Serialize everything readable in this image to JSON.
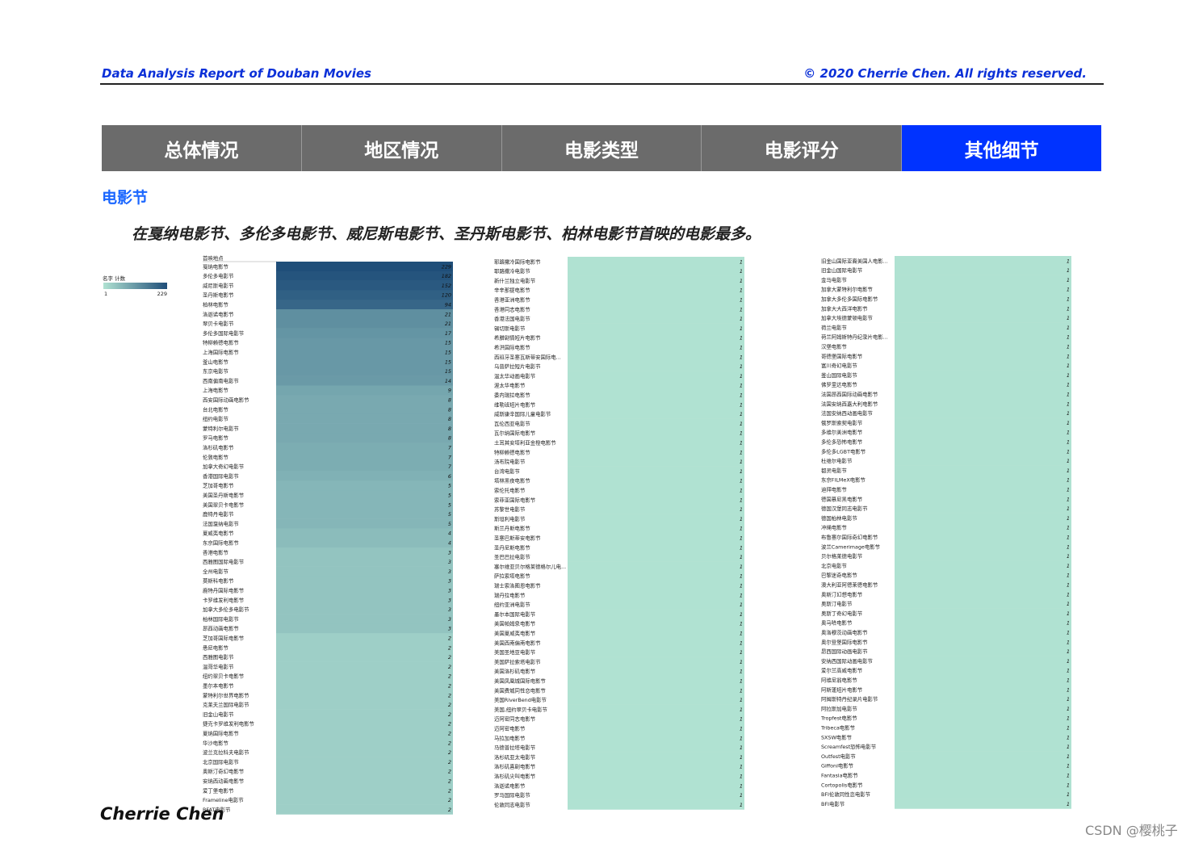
{
  "header": {
    "left": "Data Analysis Report of Douban Movies",
    "right": "© 2020 Cherrie Chen. All rights reserved."
  },
  "tabs": [
    {
      "label": "总体情况",
      "active": false
    },
    {
      "label": "地区情况",
      "active": false
    },
    {
      "label": "电影类型",
      "active": false
    },
    {
      "label": "电影评分",
      "active": false
    },
    {
      "label": "其他细节",
      "active": true
    }
  ],
  "section_title": "电影节",
  "summary": "在戛纳电影节、多伦多电影节、威尼斯电影节、圣丹斯电影节、柏林电影节首映的电影最多。",
  "author": "Cherrie Chen",
  "watermark": "CSDN @樱桃子",
  "colors": {
    "tab_bg": "#6b6b6b",
    "tab_active": "#0033ff",
    "accent_blue": "#1a66ff",
    "heat_low": "#b0e2d2",
    "heat_high": "#1f4e79"
  },
  "chart_data": {
    "type": "heatmap",
    "header_label": "首映地点",
    "legend": {
      "title": "名字 计数",
      "min_label": "1",
      "max_label": "229",
      "min": 1,
      "max": 229
    },
    "columns": [
      {
        "categories": [
          "戛纳电影节",
          "多伦多电影节",
          "威尼斯电影节",
          "圣丹斯电影节",
          "柏林电影节",
          "洛迦诺电影节",
          "翠贝卡电影节",
          "多伦多国际电影节",
          "特柳赖德电影节",
          "上海国际电影节",
          "釜山电影节",
          "东京电影节",
          "西南偏南电影节",
          "上海电影节",
          "西安国际动画电影节",
          "台北电影节",
          "纽约电影节",
          "蒙特利尔电影节",
          "罗马电影节",
          "洛杉矶电影节",
          "伦敦电影节",
          "加拿大奇幻电影节",
          "香港国际电影节",
          "芝加哥电影节",
          "美国圣丹斯电影节",
          "美国翠贝卡电影节",
          "鹿特丹电影节",
          "法国戛纳电影节",
          "夏威夷电影节",
          "东京国际电影节",
          "香港电影节",
          "西雅图国际电影节",
          "全州电影节",
          "莫斯科电影节",
          "鹿特丹国际电影节",
          "卡罗维发利电影节",
          "加拿大多伦多电影节",
          "柏林国际电影节",
          "昂西动画电影节",
          "芝加哥国际电影节",
          "悉尼电影节",
          "西雅图电影节",
          "温哥华电影节",
          "纽约翠贝卡电影节",
          "墨尔本电影节",
          "蒙特利尔世界电影节",
          "克莱夫兰国际电影节",
          "旧金山电影节",
          "捷克卡罗维发利电影节",
          "夏纳国际电影节",
          "华沙电影节",
          "波兰克拉科夫电影节",
          "北京国际电影节",
          "奥斯汀奇幻电影节",
          "安纳西动画电影节",
          "爱丁堡电影节",
          "Frameline电影节",
          "BFAT电影节"
        ],
        "values": [
          229,
          182,
          152,
          120,
          94,
          21,
          21,
          17,
          15,
          15,
          15,
          15,
          14,
          9,
          8,
          8,
          8,
          8,
          8,
          7,
          7,
          7,
          6,
          5,
          5,
          5,
          5,
          5,
          4,
          4,
          3,
          3,
          3,
          3,
          3,
          3,
          3,
          3,
          3,
          2,
          2,
          2,
          2,
          2,
          2,
          2,
          2,
          2,
          2,
          2,
          2,
          2,
          2,
          2,
          2,
          2,
          2,
          2
        ]
      },
      {
        "categories": [
          "耶路撒冷国际电影节",
          "耶路撒冷电影节",
          "新什兰独立电影节",
          "辛辛那提电影节",
          "香港亚洲电影节",
          "香港同志电影节",
          "香港法国电影节",
          "锡切斯电影节",
          "希腊剧情短片电影节",
          "希洪国际电影节",
          "西班牙圣塞瓦斯蒂安国际电...",
          "乌普萨拉短片电影节",
          "温太华动画电影节",
          "渥太华电影节",
          "委内瑞拉电影节",
          "维勒班短片电影节",
          "威斯康辛国际儿童电影节",
          "瓦伦西亚电影节",
          "瓦尔纳国际电影节",
          "土耳其安塔利亚金橙电影节",
          "特柳赖德电影节",
          "汤布院电影节",
          "台湾电影节",
          "塔林黑夜电影节",
          "索伦托电影节",
          "索菲亚国际电影节",
          "苏黎世电影节",
          "斯坦利电影节",
          "斯兰丹斯电影节",
          "圣塞巴斯蒂安电影节",
          "圣丹尼斯电影节",
          "圣巴巴拉电影节",
          "塞尔维亚贝尔格莱德格尔儿电...",
          "萨拉索塔电影节",
          "瑞士索洛图恩电影节",
          "瑞丹拉电影节",
          "纽约亚洲电影节",
          "墨尔本国际电影节",
          "美国帕姆泉电影节",
          "美国夏威夷电影节",
          "美国西南偏南电影节",
          "美国圣地亚电影节",
          "美国萨拉索塔电影节",
          "美国洛杉矶电影节",
          "美国凤凰城国际电影节",
          "美国费城同性恋电影节",
          "美国RiverBend电影节",
          "美国,纽约翠贝卡电影节",
          "迈阿密同志电影节",
          "迈阿密电影节",
          "马拉加电影节",
          "马德普拉塔电影节",
          "洛杉矶亚太电影节",
          "洛杉矶喜剧电影节",
          "洛杉矶尖叫电影节",
          "洛迦诺电影节",
          "罗马国际电影节",
          "伦敦同志电影节"
        ],
        "values": [
          1,
          1,
          1,
          1,
          1,
          1,
          1,
          1,
          1,
          1,
          1,
          1,
          1,
          1,
          1,
          1,
          1,
          1,
          1,
          1,
          1,
          1,
          1,
          1,
          1,
          1,
          1,
          1,
          1,
          1,
          1,
          1,
          1,
          1,
          1,
          1,
          1,
          1,
          1,
          1,
          1,
          1,
          1,
          1,
          1,
          1,
          1,
          1,
          1,
          1,
          1,
          1,
          1,
          1,
          1,
          1,
          1,
          1
        ]
      },
      {
        "categories": [
          "旧金山国际亚裔美国人电影...",
          "旧金山国际电影节",
          "金马电影节",
          "加拿大蒙特利尔电影节",
          "加拿大多伦多国际电影节",
          "加拿大大西洋电影节",
          "加拿大埃德蒙顿电影节",
          "荷兰电影节",
          "荷兰阿姆斯特丹纪录片电影...",
          "汉堡电影节",
          "哥德堡国际电影节",
          "富川奇幻电影节",
          "釜山国际电影节",
          "佛罗里达电影节",
          "法国昂西国际动画电影节",
          "法国安纳西嘉大利电影节",
          "法国安纳西动画电影节",
          "俄罗斯索契电影节",
          "多维尔美洲电影节",
          "多伦多恐怖电影节",
          "多伦多LGBT电影节",
          "杜维尔电影节",
          "都灵电影节",
          "东京FILMeX电影节",
          "迪拜电影节",
          "德国慕尼黑电影节",
          "德国汉堡同志电影节",
          "德国柏林电影节",
          "冲绳电影节",
          "布鲁塞尔国际奇幻电影节",
          "波兰Camerimage电影节",
          "贝尔格莱德电影节",
          "北京电影节",
          "巴黎迷奇电影节",
          "澳大利亚阿德莱德电影节",
          "奥斯汀幻想电影节",
          "奥斯汀电影节",
          "奥斯丁奇幻电影节",
          "奥马哈电影节",
          "奥洛穆茨动画电影节",
          "奥尔登堡国际电影节",
          "昂西国际动画电影节",
          "安纳西国际动画电影节",
          "爱尔兰高威电影节",
          "阿维尼翁电影节",
          "阿斯蓬短片电影节",
          "阿姆斯特丹纪录片电影节",
          "阿拉斯加电影节",
          "Tropfest电影节",
          "Tribeca电影节",
          "SXSW电影节",
          "Screamfest恐怖电影节",
          "Outfest电影节",
          "Giffoni电影节",
          "Fantasia电影节",
          "Cortopolis电影节",
          "BFI伦敦同性恋电影节",
          "BFI电影节"
        ],
        "values": [
          1,
          1,
          1,
          1,
          1,
          1,
          1,
          1,
          1,
          1,
          1,
          1,
          1,
          1,
          1,
          1,
          1,
          1,
          1,
          1,
          1,
          1,
          1,
          1,
          1,
          1,
          1,
          1,
          1,
          1,
          1,
          1,
          1,
          1,
          1,
          1,
          1,
          1,
          1,
          1,
          1,
          1,
          1,
          1,
          1,
          1,
          1,
          1,
          1,
          1,
          1,
          1,
          1,
          1,
          1,
          1,
          1,
          1
        ]
      }
    ]
  }
}
